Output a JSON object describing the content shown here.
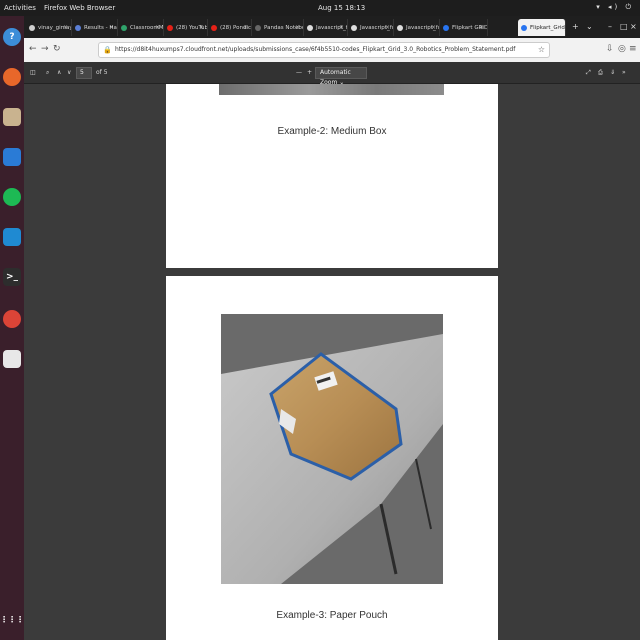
{
  "topbar": {
    "activities": "Activities",
    "app_name": "Firefox Web Browser",
    "clock": "Aug 15 18:13",
    "system_icons": "▾ ◂) ⏻"
  },
  "dock": {
    "items": [
      {
        "name": "help",
        "color": "#3c8dd8",
        "glyph": "?"
      },
      {
        "name": "firefox",
        "color": "#e8672a",
        "glyph": ""
      },
      {
        "name": "files",
        "color": "#c9b38f",
        "glyph": ""
      },
      {
        "name": "writer",
        "color": "#2a7bd6",
        "glyph": ""
      },
      {
        "name": "spotify",
        "color": "#1db954",
        "glyph": ""
      },
      {
        "name": "vscode",
        "color": "#1f8ad2",
        "glyph": ""
      },
      {
        "name": "terminal",
        "color": "#2d2d2d",
        "glyph": ">_"
      },
      {
        "name": "chrome",
        "color": "#db4437",
        "glyph": ""
      },
      {
        "name": "doc",
        "color": "#e8e8e8",
        "glyph": ""
      }
    ],
    "apps_grid": "⋮⋮⋮"
  },
  "tabs": [
    {
      "label": "vinay_gimay...",
      "favicon_color": "#cfcfcf"
    },
    {
      "label": "Results - Hai",
      "favicon_color": "#5b7fd6"
    },
    {
      "label": "ClassroomMcli",
      "favicon_color": "#2fa36b"
    },
    {
      "label": "(28) YouTube",
      "favicon_color": "#e62117"
    },
    {
      "label": "(28) Pondicl",
      "favicon_color": "#e62117"
    },
    {
      "label": "Pandas Notebook",
      "favicon_color": "#666666"
    },
    {
      "label": "Javascript_fu",
      "favicon_color": "#dddddd"
    },
    {
      "label": "Javascript_fu",
      "favicon_color": "#dddddd"
    },
    {
      "label": "Javascript_fu",
      "favicon_color": "#dddddd"
    },
    {
      "label": "Flipkart GRiD",
      "favicon_color": "#2874f0"
    },
    {
      "label": "Flipkart_Grid_3.0",
      "favicon_color": "#2874f0",
      "active": true
    }
  ],
  "nav": {
    "url": "https://d8it4huxumps7.cloudfront.net/uploads/submissions_case/6f4b5510-codes_Flipkart_Grid_3.0_Robotics_Problem_Statement.pdf"
  },
  "pdf_toolbar": {
    "page_current": "5",
    "page_total": "of 5",
    "zoom": "Automatic Zoom"
  },
  "document": {
    "captions": [
      "Example-2: Medium Box",
      "Example-3: Paper Pouch"
    ]
  }
}
